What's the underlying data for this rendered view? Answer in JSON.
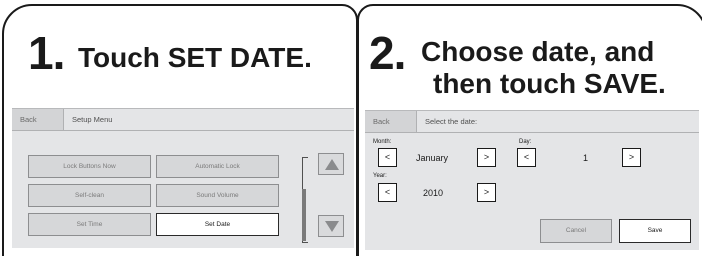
{
  "step1": {
    "number": "1.",
    "instruction": "Touch SET DATE.",
    "screen": {
      "back_label": "Back",
      "title": "Setup Menu",
      "buttons": {
        "lock_buttons_now": "Lock Buttons Now",
        "automatic_lock": "Automatic Lock",
        "self_clean": "Self-clean",
        "sound_volume": "Sound Volume",
        "set_time": "Set Time",
        "set_date": "Set Date"
      },
      "selected_button": "Set Date"
    }
  },
  "step2": {
    "number": "2.",
    "instruction_line1": "Choose date, and",
    "instruction_line2": "then touch SAVE.",
    "screen": {
      "back_label": "Back",
      "title": "Select the date:",
      "month_label": "Month:",
      "month_value": "January",
      "day_label": "Day:",
      "day_value": "1",
      "year_label": "Year:",
      "year_value": "2010",
      "decrement_symbol": "<",
      "increment_symbol": ">",
      "cancel_label": "Cancel",
      "save_label": "Save"
    }
  },
  "icons": {
    "scroll_up": "triangle-up-icon",
    "scroll_down": "triangle-down-icon"
  },
  "colors": {
    "border": "#1a1a1a",
    "screen_bg": "#e4e5e7",
    "button_bg": "#d6d7d9",
    "active_button_bg": "#ffffff"
  }
}
